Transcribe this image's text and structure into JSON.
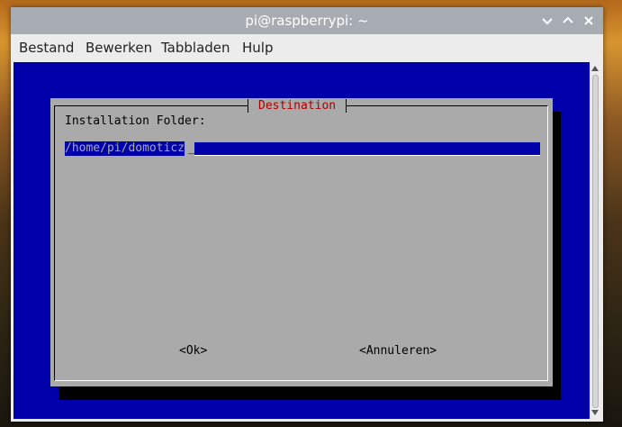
{
  "window": {
    "title": "pi@raspberrypi: ~"
  },
  "menubar": {
    "items": [
      "Bestand",
      "Bewerken",
      "Tabbladen",
      "Hulp"
    ]
  },
  "dialog": {
    "title": "Destination",
    "label": "Installation Folder:",
    "input_value": "/home/pi/domoticz",
    "cursor": "_",
    "ok_button": "<Ok>",
    "cancel_button": "<Annuleren>"
  },
  "icons": {
    "minimize": "chevron-down-icon",
    "maximize": "chevron-up-icon",
    "close": "close-icon",
    "scroll_up": "scroll-up-arrow-icon",
    "scroll_down": "scroll-down-arrow-icon"
  },
  "colors": {
    "titlebar": "#a7acb3",
    "terminal_background": "#0000aa",
    "dialog_background": "#aaaaaa",
    "dialog_title": "#aa0000",
    "input_background": "#0000aa"
  }
}
